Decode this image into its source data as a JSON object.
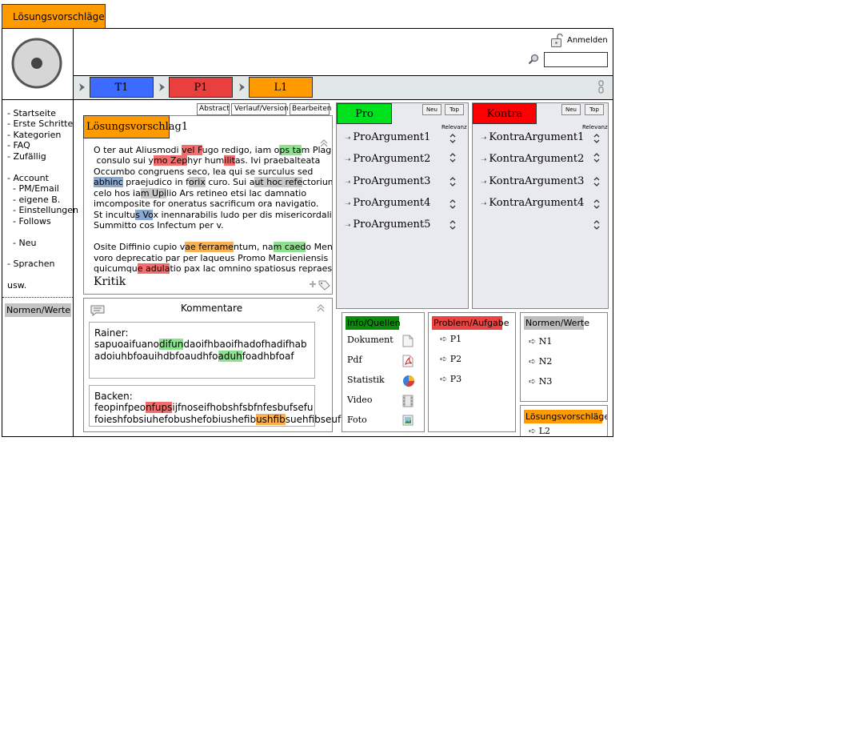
{
  "top_tab": {
    "label": "Lösungsvorschläge"
  },
  "header": {
    "login_label": "Anmelden",
    "search": {
      "value": "",
      "placeholder": ""
    }
  },
  "breadcrumb": [
    {
      "label": "T1",
      "color": "#3b6bff"
    },
    {
      "label": "P1",
      "color": "#ea3f3f"
    },
    {
      "label": "L1",
      "color": "#ff9b00"
    }
  ],
  "sidebar": {
    "items": [
      "- Startseite",
      "- Erste Schritte",
      "- Kategorien",
      "- FAQ",
      "- Zufällig",
      "- Account",
      "  - PM/Email",
      "  - eigene B.",
      "  - Einstellungen",
      "  - Follows",
      "  - Neu",
      "- Sprachen",
      "usw."
    ],
    "footer_label": "Normen/Werte"
  },
  "article": {
    "buttons": {
      "abstract": "Abstract",
      "history": "Verlauf/Version",
      "edit": "Bearbeiten"
    },
    "tag": "Lösungsvorschlag",
    "title_suffix": "1",
    "para1": {
      "l1a": "O ter aut Aliusmodi ",
      "l1b": "vel F",
      "l1c": "ugo redigo, iam o",
      "l1d": "ps ta",
      "l1e": "m Plaga",
      "l2a": " consulo sui y",
      "l2b": "mo Zep",
      "l2c": "hyr hum",
      "l2d": "ilit",
      "l2e": "as. Ivi praebalteata",
      "l3": "Occumbo congruens seco, lea qui se surculus sed",
      "l4a": "abhinc",
      "l4b": " praejudico in f",
      "l4c": "orix",
      "l4d": " curo. Sui a",
      "l4e": "ut hoc refe",
      "l4f": "ctorium",
      "l5a": "celo hos ia",
      "l5b": "m Upi",
      "l5c": "lio Ars retineo etsi lac damnatio",
      "l6": "imcomposite for oneratus sacrificum ora navigatio.",
      "l7a": "St incultu",
      "l7b": "s Vo",
      "l7c": "x inennarabilis ludo per dis misericordaliter",
      "l8": "Summitto cos Infectum per v."
    },
    "para2": {
      "l1a": "Osite Diffinio cupio v",
      "l1b": "ae ferrame",
      "l1c": "ntum, na",
      "l1d": "m caed",
      "l1e": "o Mensa",
      "l2": "voro deprecatio par per laqueus Promo Marcieniensis",
      "l3a": "quicumqu",
      "l3b": "e adula",
      "l3c": "tio pax lac omnino spatiosus repraesento"
    },
    "kritik_label": "Kritik"
  },
  "comments": {
    "title": "Kommentare",
    "items": [
      {
        "author": "Rainer:",
        "l1a": "sapuoaifuano",
        "l1b": "difun",
        "l1c": "daoifhbaoifhadofhadifhab",
        "l2a": "adoiuhbfoauihdbfoaudhfo",
        "l2b": "aduh",
        "l2c": "foadhbfoaf"
      },
      {
        "author": "Backen:",
        "l1a": "feopinfpeo",
        "l1b": "nfups",
        "l1c": "ijfnoseifhobshfsbfnfesbufsefu",
        "l2a": "foieshfobsiuhefobushefobiushefib",
        "l2b": "ushfib",
        "l2c": "suehfibseuf"
      }
    ]
  },
  "pro": {
    "title": "Pro",
    "color": "#00e11e",
    "new_label": "Neu",
    "top_label": "Top",
    "relevance_label": "Relevanz",
    "items": [
      "ProArgument1",
      "ProArgument2",
      "ProArgument3",
      "ProArgument4",
      "ProArgument5"
    ]
  },
  "kontra": {
    "title": "Kontra",
    "color": "#ff0000",
    "new_label": "Neu",
    "top_label": "Top",
    "relevance_label": "Relevanz",
    "items": [
      "KontraArgument1",
      "KontraArgument2",
      "KontraArgument3",
      "KontraArgument4"
    ]
  },
  "info": {
    "title": "Info/Quellen",
    "color": "#0b8a0b",
    "items": [
      {
        "label": "Dokument",
        "icon": "document-icon"
      },
      {
        "label": "Pdf",
        "icon": "pdf-icon"
      },
      {
        "label": "Statistik",
        "icon": "pie-chart-icon"
      },
      {
        "label": "Video",
        "icon": "video-icon"
      },
      {
        "label": "Foto",
        "icon": "photo-icon"
      }
    ]
  },
  "problem": {
    "title": "Problem/Aufgabe",
    "color": "#e94444",
    "items": [
      "P1",
      "P2",
      "P3"
    ]
  },
  "norms": {
    "title": "Normen/Werte",
    "color": "#bdbdbd",
    "items": [
      "N1",
      "N2",
      "N3"
    ]
  },
  "solutions": {
    "title": "Lösungsvorschläge",
    "color": "#ff9b00",
    "items": [
      "L2"
    ]
  }
}
